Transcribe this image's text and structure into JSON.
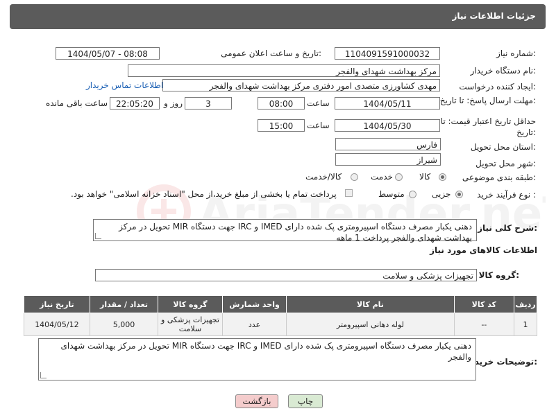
{
  "header": {
    "title": "جزئیات اطلاعات نیاز"
  },
  "fields": {
    "need_number_label": "شماره نیاز:",
    "need_number": "1104091591000032",
    "announce_label": "تاریخ و ساعت اعلان عمومی:",
    "announce_value": "1404/05/07 - 08:08",
    "buyer_org_label": "نام دستگاه خریدار:",
    "buyer_org": "مرکز بهداشت شهدای والفجر",
    "creator_label": "ایجاد کننده درخواست:",
    "creator": "مهدی کشاورزی متصدی امور دفتری مرکز بهداشت شهدای والفجر",
    "buyer_contact_link": "اطلاعات تماس خریدار",
    "deadline_label": "مهلت ارسال پاسخ: تا تاریخ:",
    "deadline_date": "1404/05/11",
    "time_label": "ساعت",
    "deadline_time": "08:00",
    "days_value": "3",
    "days_label": "روز و",
    "remaining_time": "22:05:20",
    "remaining_label": "ساعت باقی مانده",
    "min_price_label": "حداقل تاریخ اعتبار قیمت: تا تاریخ:",
    "min_price_date": "1404/05/30",
    "min_price_time": "15:00",
    "province_label": "استان محل تحویل:",
    "province": "فارس",
    "city_label": "شهر محل تحویل:",
    "city": "شیراز",
    "category_label": "طبقه بندی موضوعی:",
    "category_options": [
      "کالا",
      "خدمت",
      "کالا/خدمت"
    ],
    "process_label": "نوع فرآیند خرید :",
    "process_options": [
      "جزیی",
      "متوسط"
    ],
    "payment_note": "پرداخت تمام یا بخشی از مبلغ خرید،از محل \"اسناد خزانه اسلامی\" خواهد بود.",
    "description_label": "شرح کلی نیاز:",
    "description": "دهنی یکبار مصرف دستگاه اسپیرومتری پک شده  دارای IMED  و IRC جهت دستگاه MIR تحویل در مرکز بهداشت شهدای والفجر پرداخت 1 ماهه",
    "goods_info_title": "اطلاعات کالاهای مورد نیاز",
    "goods_group_label": "گروه کالا:",
    "goods_group": "تجهیزات پزشکی و سلامت"
  },
  "table": {
    "headers": [
      "ردیف",
      "کد کالا",
      "نام کالا",
      "واحد شمارش",
      "گروه کالا",
      "تعداد / مقدار",
      "تاریخ نیاز"
    ],
    "rows": [
      [
        "1",
        "--",
        "لوله دهانی اسپیرومتر",
        "عدد",
        "تجهیزات پزشکی و سلامت",
        "5,000",
        "1404/05/12"
      ]
    ]
  },
  "buyer_notes_label": "توضیحات خریدار:",
  "buyer_notes": "دهنی یکبار مصرف دستگاه اسپیرومتری پک شده  دارای IMED  و IRC جهت دستگاه MIR تحویل در مرکز بهداشت شهدای والفجر",
  "buttons": {
    "print": "چاپ",
    "back": "بازگشت"
  },
  "watermark": "AriaTender.neT",
  "colors": {
    "header_bg": "#5b5b5b",
    "link": "#1a5fb4",
    "back_btn": "#f4cccc",
    "print_btn": "#d9ead3"
  }
}
